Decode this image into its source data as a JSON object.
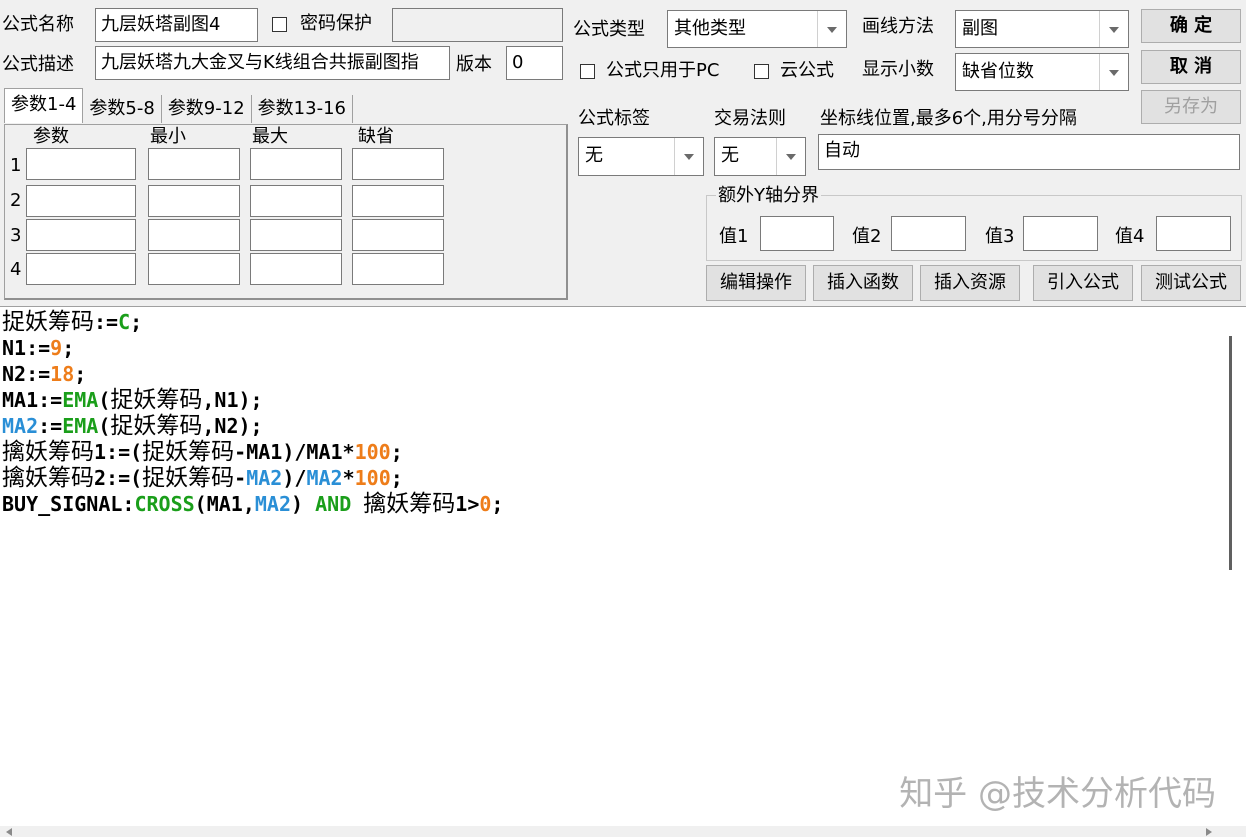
{
  "form": {
    "name_label": "公式名称",
    "name_value": "九层妖塔副图4",
    "password_label": "密码保护",
    "desc_label": "公式描述",
    "desc_value": "九层妖塔九大金叉与K线组合共振副图指",
    "version_label": "版本",
    "version_value": "0"
  },
  "settings": {
    "type_label": "公式类型",
    "type_value": "其他类型",
    "draw_label": "画线方法",
    "draw_value": "副图",
    "pc_only_label": "公式只用于PC",
    "cloud_label": "云公式",
    "decimals_label": "显示小数",
    "decimals_value": "缺省位数",
    "tag_label": "公式标签",
    "tag_value": "无",
    "rule_label": "交易法则",
    "rule_value": "无",
    "axis_label": "坐标线位置,最多6个,用分号分隔",
    "axis_value": "自动",
    "extra_y_label": "额外Y轴分界",
    "value_labels": [
      "值1",
      "值2",
      "值3",
      "值4"
    ]
  },
  "buttons": {
    "ok": "确  定",
    "cancel": "取  消",
    "save_as": "另存为",
    "edit_ops": "编辑操作",
    "insert_fn": "插入函数",
    "insert_res": "插入资源",
    "import": "引入公式",
    "test": "测试公式"
  },
  "params": {
    "tabs": [
      "参数1-4",
      "参数5-8",
      "参数9-12",
      "参数13-16"
    ],
    "headers": [
      "参数",
      "最小",
      "最大",
      "缺省"
    ],
    "rows": [
      "1",
      "2",
      "3",
      "4"
    ]
  },
  "code": {
    "line1": {
      "a": "捉妖筹码",
      "b": ":=",
      "c": "C",
      "d": ";"
    },
    "line2": {
      "a": "N1:=",
      "b": "9",
      "c": ";"
    },
    "line3": {
      "a": "N2:=",
      "b": "18",
      "c": ";"
    },
    "line4": {
      "a": "MA1:=",
      "b": "EMA",
      "c": "(",
      "d": "捉妖筹码",
      "e": ",N1);"
    },
    "line5": {
      "a": "MA2",
      "b": ":=",
      "c": "EMA",
      "d": "(",
      "e": "捉妖筹码",
      "f": ",N2);"
    },
    "line6": {
      "a": "擒妖筹码",
      "b": "1:=(",
      "c": "捉妖筹码",
      "d": "-MA1)/MA1*",
      "e": "100",
      "f": ";"
    },
    "line7": {
      "a": "擒妖筹码",
      "b": "2:=(",
      "c": "捉妖筹码",
      "d": "-",
      "e": "MA2",
      "f": ")/",
      "g": "MA2",
      "h": "*",
      "i": "100",
      "j": ";"
    },
    "line8": {
      "a": "BUY_SIGNAL:",
      "b": "CROSS",
      "c": "(MA1,",
      "d": "MA2",
      "e": ") ",
      "f": "AND",
      "g": " ",
      "h": "擒妖筹码",
      "i": "1>",
      "j": "0",
      "k": ";"
    }
  },
  "watermark": "知乎 @技术分析代码",
  "colors": {
    "function": "#1a9e1a",
    "number": "#ee7d1a",
    "variable": "#2a8fd6"
  }
}
